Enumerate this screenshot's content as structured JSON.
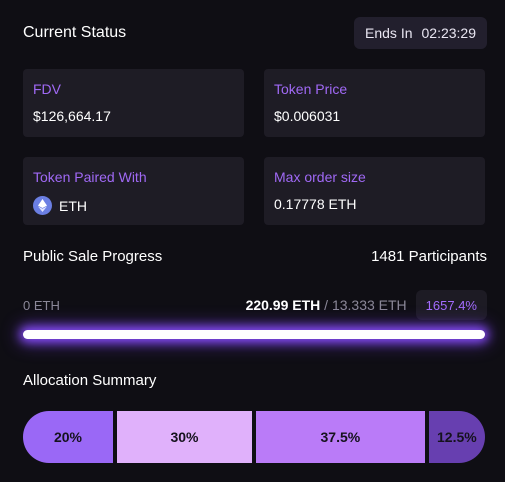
{
  "header": {
    "title": "Current Status",
    "ends_label": "Ends In",
    "ends_time": "02:23:29"
  },
  "cards": {
    "fdv": {
      "label": "FDV",
      "value": "$126,664.17"
    },
    "token_price": {
      "label": "Token Price",
      "value": "$0.006031"
    },
    "paired": {
      "label": "Token Paired With",
      "value": "ETH",
      "icon": "eth-icon"
    },
    "max_order": {
      "label": "Max order size",
      "value": "0.17778 ETH"
    }
  },
  "sale": {
    "title": "Public Sale Progress",
    "participants": "1481 Participants",
    "min_label": "0 ETH",
    "raised": "220.99 ETH",
    "separator": "/",
    "target": "13.333 ETH",
    "percent": "1657.4%",
    "progress_fraction": 1.0
  },
  "allocation": {
    "title": "Allocation Summary",
    "segments": [
      {
        "label": "20%",
        "share": 20,
        "color": "#9a68f6"
      },
      {
        "label": "30%",
        "share": 30,
        "color": "#e0b1fb"
      },
      {
        "label": "37.5%",
        "share": 37.5,
        "color": "#ba7bf8"
      },
      {
        "label": "12.5%",
        "share": 12.5,
        "color": "#673fb0"
      }
    ]
  },
  "colors": {
    "background": "#0f0e14",
    "card": "#1e1c25",
    "accent": "#a069f5",
    "glow": "#8a4dff"
  }
}
